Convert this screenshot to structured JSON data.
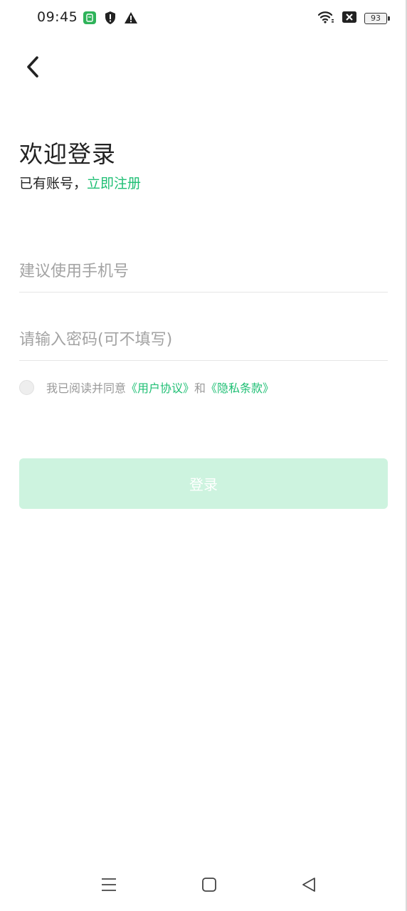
{
  "status_bar": {
    "time": "09:45",
    "battery": "93",
    "icons_left": [
      "app-notification-icon",
      "shield-icon",
      "warning-icon"
    ],
    "icons_right": [
      "wifi-icon",
      "no-sim-icon",
      "battery-icon"
    ]
  },
  "header": {
    "back_icon": "chevron-left-icon"
  },
  "welcome": {
    "title": "欢迎登录",
    "prompt": "已有账号，",
    "register_link": "立即注册"
  },
  "form": {
    "phone_placeholder": "建议使用手机号",
    "password_placeholder": "请输入密码(可不填写)",
    "agreement": {
      "prefix": "我已阅读并同意",
      "user_agreement": "《用户协议》",
      "and": "和",
      "privacy_policy": "《隐私条款》",
      "checked": false
    },
    "login_label": "登录"
  },
  "nav_bar": {
    "icons": [
      "menu-icon",
      "home-square-icon",
      "back-triangle-icon"
    ]
  },
  "colors": {
    "accent": "#1fbf74",
    "button_disabled": "#cdf3df",
    "placeholder": "#a3a3a3",
    "text": "#222222"
  }
}
